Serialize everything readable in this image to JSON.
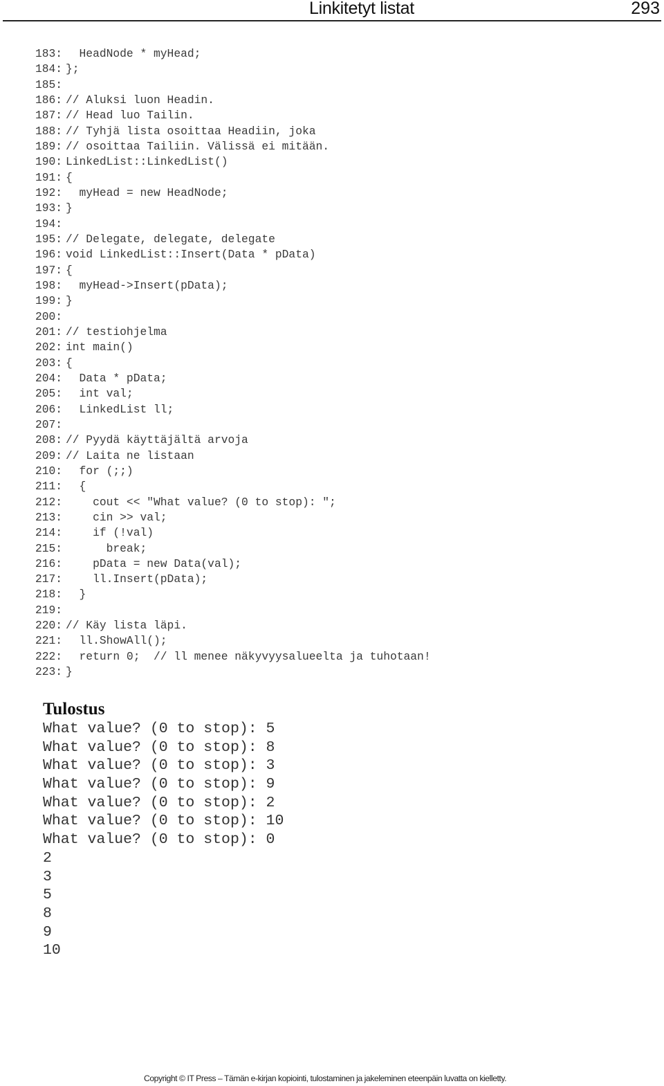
{
  "header": {
    "title": "Linkitetyt listat",
    "page_number": "293"
  },
  "code": {
    "lines": [
      {
        "num": "183:",
        "text": "  HeadNode * myHead;"
      },
      {
        "num": "184:",
        "text": "};"
      },
      {
        "num": "185:",
        "text": ""
      },
      {
        "num": "186:",
        "text": "// Aluksi luon Headin."
      },
      {
        "num": "187:",
        "text": "// Head luo Tailin."
      },
      {
        "num": "188:",
        "text": "// Tyhjä lista osoittaa Headiin, joka"
      },
      {
        "num": "189:",
        "text": "// osoittaa Tailiin. Välissä ei mitään."
      },
      {
        "num": "190:",
        "text": "LinkedList::LinkedList()"
      },
      {
        "num": "191:",
        "text": "{"
      },
      {
        "num": "192:",
        "text": "  myHead = new HeadNode;"
      },
      {
        "num": "193:",
        "text": "}"
      },
      {
        "num": "194:",
        "text": ""
      },
      {
        "num": "195:",
        "text": "// Delegate, delegate, delegate"
      },
      {
        "num": "196:",
        "text": "void LinkedList::Insert(Data * pData)"
      },
      {
        "num": "197:",
        "text": "{"
      },
      {
        "num": "198:",
        "text": "  myHead->Insert(pData);"
      },
      {
        "num": "199:",
        "text": "}"
      },
      {
        "num": "200:",
        "text": ""
      },
      {
        "num": "201:",
        "text": "// testiohjelma"
      },
      {
        "num": "202:",
        "text": "int main()"
      },
      {
        "num": "203:",
        "text": "{"
      },
      {
        "num": "204:",
        "text": "  Data * pData;"
      },
      {
        "num": "205:",
        "text": "  int val;"
      },
      {
        "num": "206:",
        "text": "  LinkedList ll;"
      },
      {
        "num": "207:",
        "text": ""
      },
      {
        "num": "208:",
        "text": "// Pyydä käyttäjältä arvoja"
      },
      {
        "num": "209:",
        "text": "// Laita ne listaan"
      },
      {
        "num": "210:",
        "text": "  for (;;)"
      },
      {
        "num": "211:",
        "text": "  {"
      },
      {
        "num": "212:",
        "text": "    cout << \"What value? (0 to stop): \";"
      },
      {
        "num": "213:",
        "text": "    cin >> val;"
      },
      {
        "num": "214:",
        "text": "    if (!val)"
      },
      {
        "num": "215:",
        "text": "      break;"
      },
      {
        "num": "216:",
        "text": "    pData = new Data(val);"
      },
      {
        "num": "217:",
        "text": "    ll.Insert(pData);"
      },
      {
        "num": "218:",
        "text": "  }"
      },
      {
        "num": "219:",
        "text": ""
      },
      {
        "num": "220:",
        "text": "// Käy lista läpi."
      },
      {
        "num": "221:",
        "text": "  ll.ShowAll();"
      },
      {
        "num": "222:",
        "text": "  return 0;  // ll menee näkyvyysalueelta ja tuhotaan!"
      },
      {
        "num": "223:",
        "text": "}"
      }
    ]
  },
  "output": {
    "title": "Tulostus",
    "lines": [
      "What value? (0 to stop): 5",
      "What value? (0 to stop): 8",
      "What value? (0 to stop): 3",
      "What value? (0 to stop): 9",
      "What value? (0 to stop): 2",
      "What value? (0 to stop): 10",
      "What value? (0 to stop): 0",
      "2",
      "3",
      "5",
      "8",
      "9",
      "10"
    ]
  },
  "footer": {
    "copyright": "Copyright © IT Press – Tämän e-kirjan kopiointi, tulostaminen ja jakeleminen eteenpäin luvatta on kielletty."
  }
}
